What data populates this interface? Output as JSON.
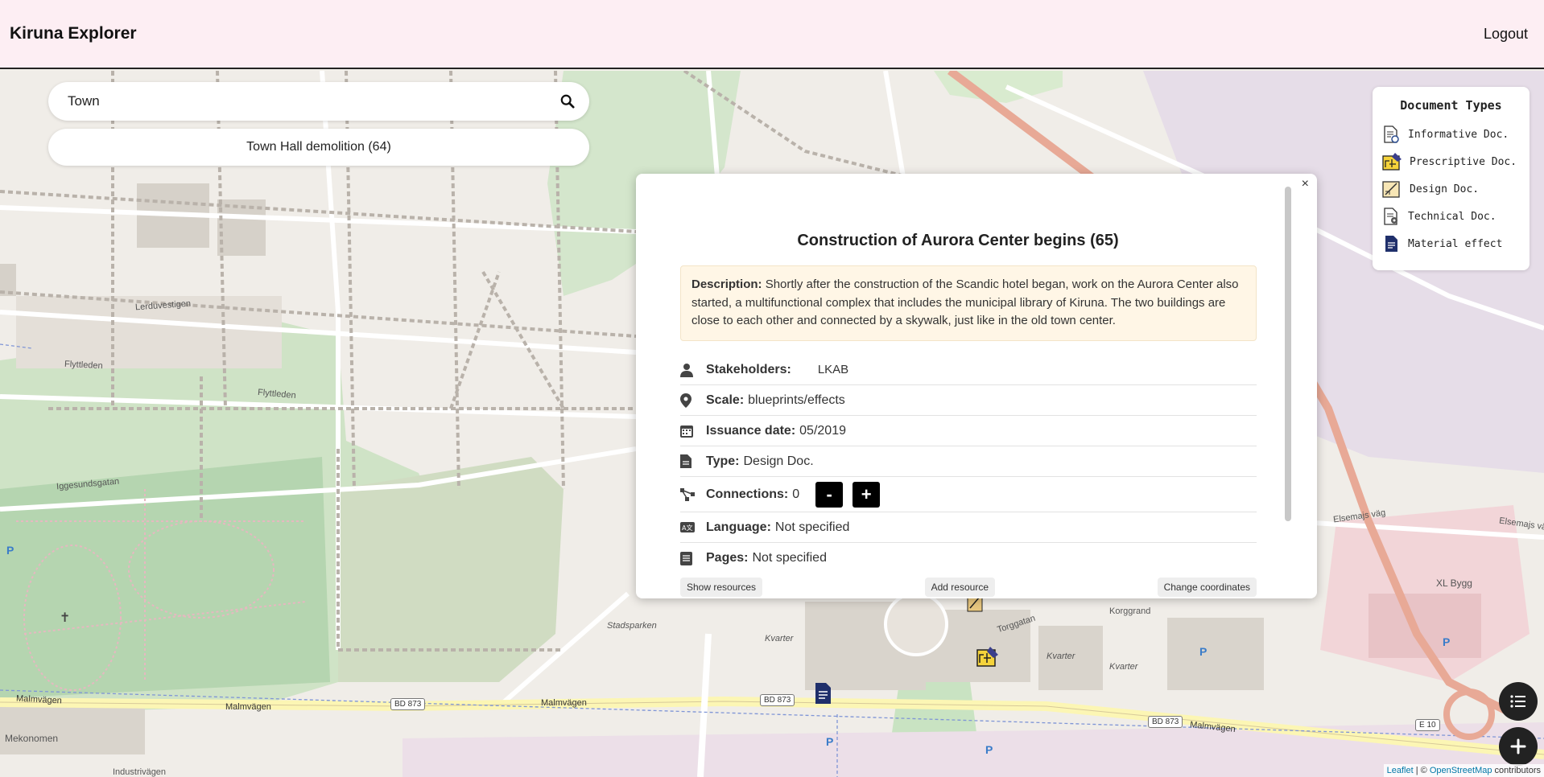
{
  "app": {
    "title": "Kiruna Explorer",
    "logout_label": "Logout"
  },
  "search": {
    "value": "Town",
    "placeholder": "Search",
    "suggestion": "Town Hall demolition (64)"
  },
  "legend": {
    "title": "Document Types",
    "items": [
      {
        "label": "Informative Doc.",
        "icon": "informative-doc-icon"
      },
      {
        "label": "Prescriptive Doc.",
        "icon": "prescriptive-doc-icon"
      },
      {
        "label": "Design Doc.",
        "icon": "design-doc-icon"
      },
      {
        "label": "Technical Doc.",
        "icon": "technical-doc-icon"
      },
      {
        "label": "Material effect",
        "icon": "material-effect-icon"
      }
    ]
  },
  "modal": {
    "title": "Construction of Aurora Center begins (65)",
    "description_label": "Description:",
    "description": "Shortly after the construction of the Scandic hotel began, work on the Aurora Center also started, a multifunctional complex that includes the municipal library of Kiruna. The two buildings are close to each other and connected by a skywalk, just like in the old town center.",
    "stakeholders_label": "Stakeholders:",
    "stakeholders": "LKAB",
    "scale_label": "Scale:",
    "scale": "blueprints/effects",
    "date_label": "Issuance date:",
    "date": "05/2019",
    "type_label": "Type:",
    "type": "Design Doc.",
    "connections_label": "Connections:",
    "connections": "0",
    "minus_label": "-",
    "plus_label": "+",
    "language_label": "Language:",
    "language": "Not specified",
    "pages_label": "Pages:",
    "pages": "Not specified",
    "show_resources": "Show resources",
    "add_resource": "Add resource",
    "change_coordinates": "Change coordinates",
    "close_label": "×"
  },
  "map_labels": {
    "malmvagen": "Malmvägen",
    "bd873": "BD 873",
    "e10": "E 10",
    "torggatan": "Torggatan",
    "korggrand": "Korggrand",
    "stadsparken": "Stadsparken",
    "xlbygg": "XL Bygg",
    "mekonomen": "Mekonomen",
    "flyttleden": "Flyttleden",
    "iggesundsgatan": "Iggesundsgatan",
    "lerduvestigen": "Lerduvestigen",
    "elsemajsvag": "Elsemajs väg",
    "industrivagen": "Industrivägen",
    "kvarter": "Kvarter"
  },
  "attribution": {
    "leaflet": "Leaflet",
    "sep": " | © ",
    "osm": "OpenStreetMap",
    "suffix": " contributors"
  },
  "colors": {
    "header_bg": "#fdeef3",
    "desc_bg": "#fff6e6",
    "park": "#cde3c8",
    "road_primary": "#fdfbd0"
  }
}
